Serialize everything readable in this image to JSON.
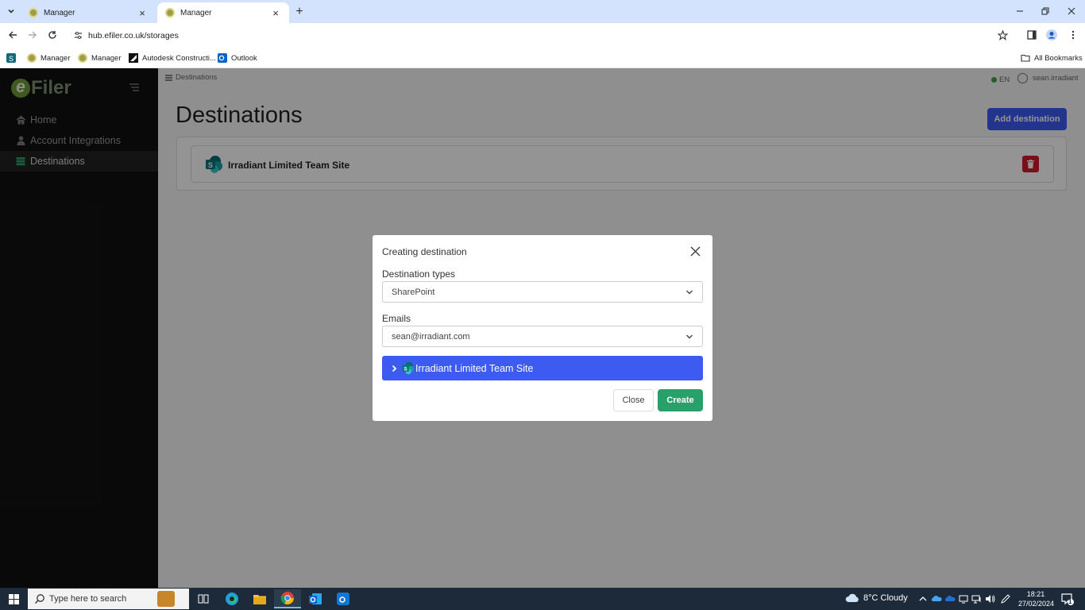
{
  "browser": {
    "tabs": [
      {
        "title": "Manager",
        "active": false
      },
      {
        "title": "Manager",
        "active": true
      }
    ],
    "url": "hub.efiler.co.uk/storages",
    "bookmarks": [
      {
        "label": "Manager",
        "icon": "manager-favicon"
      },
      {
        "label": "Manager",
        "icon": "manager-favicon"
      },
      {
        "label": "Autodesk Constructi...",
        "icon": "autodesk-icon"
      },
      {
        "label": "Outlook",
        "icon": "outlook-icon"
      }
    ],
    "all_bookmarks": "All Bookmarks"
  },
  "app": {
    "logo_e": "e",
    "logo_filer": "Filer",
    "nav": [
      {
        "label": "Home",
        "icon": "home-icon",
        "active": false
      },
      {
        "label": "Account Integrations",
        "icon": "user-icon",
        "active": false
      },
      {
        "label": "Destinations",
        "icon": "database-icon",
        "active": true
      }
    ],
    "breadcrumb": "Destinations",
    "language": "EN",
    "username": "sean.irradiant",
    "page_title": "Destinations",
    "add_button": "Add destination",
    "destinations": [
      {
        "name": "Irradiant Limited Team Site",
        "icon": "sharepoint-icon"
      }
    ]
  },
  "modal": {
    "title": "Creating destination",
    "type_label": "Destination types",
    "type_value": "SharePoint",
    "emails_label": "Emails",
    "emails_value": "sean@irradiant.com",
    "site_item": "Irradiant Limited Team Site",
    "close_button": "Close",
    "create_button": "Create"
  },
  "taskbar": {
    "search_placeholder": "Type here to search",
    "weather": "8°C  Cloudy",
    "time": "18:21",
    "date": "27/02/2024",
    "notification_count": "1"
  },
  "colors": {
    "primary": "#3d5af1",
    "success": "#28a06a",
    "danger": "#d11a2a",
    "sidebar": "#111111"
  }
}
